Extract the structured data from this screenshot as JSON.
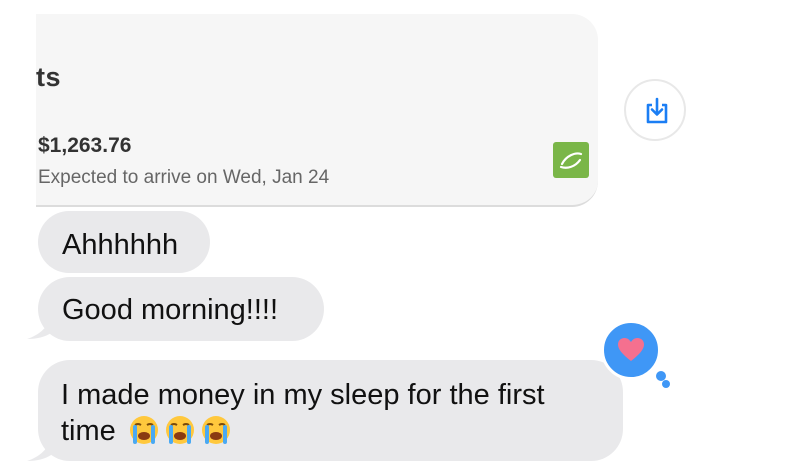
{
  "card": {
    "title": "ts",
    "amount": "$1,263.76",
    "subtitle": "Expected to arrive on Wed, Jan 24",
    "logo_icon": "brand-logo-icon",
    "logo_color": "#7ab648",
    "download_icon": "download-icon"
  },
  "messages": [
    {
      "text": "Ahhhhhh"
    },
    {
      "text": "Good morning!!!!"
    },
    {
      "line1": "I made money in my sleep for the first",
      "line2": "time"
    }
  ],
  "reaction": {
    "icon": "heart-icon",
    "bubble_color": "#3f97f6",
    "heart_color": "#f5708f"
  },
  "emoji": [
    "loudly-crying-face-icon",
    "loudly-crying-face-icon",
    "loudly-crying-face-icon"
  ]
}
